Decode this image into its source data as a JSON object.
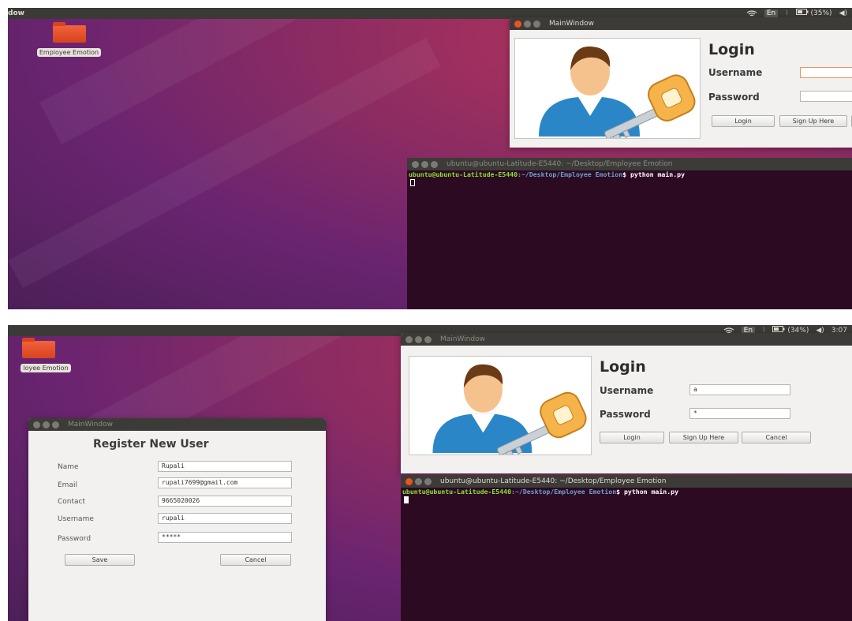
{
  "top_bar": {
    "app_title": "dow",
    "tray_lang": "En",
    "tray_battery_1": "(35%)",
    "tray_battery_2": "(34%)",
    "tray_time_2": "3:07"
  },
  "desktop": {
    "folder_label_1": "Employee Emotion",
    "folder_label_2": "loyee Emotion"
  },
  "login_window": {
    "title": "MainWindow",
    "heading": "Login",
    "username_label": "Username",
    "password_label": "Password",
    "username_value_2": "a",
    "password_value_2": "*",
    "login_button": "Login",
    "signup_button": "Sign Up Here",
    "cancel_button": "Cancel"
  },
  "terminal": {
    "title": "ubuntu@ubuntu-Latitude-E5440: ~/Desktop/Employee Emotion",
    "prompt_user": "ubuntu@ubuntu-Latitude-E5440",
    "prompt_path": ":~/Desktop/Employee Emotion",
    "command": "$ python main.py"
  },
  "register_window": {
    "title": "MainWindow",
    "heading": "Register New User",
    "fields": [
      {
        "label": "Name",
        "value": "Rupali"
      },
      {
        "label": "Email",
        "value": "rupali7699@gmail.com"
      },
      {
        "label": "Contact",
        "value": "9665020026"
      },
      {
        "label": "Username",
        "value": "rupali"
      },
      {
        "label": "Password",
        "value": "*****"
      }
    ],
    "save_button": "Save",
    "cancel_button": "Cancel"
  },
  "colors": {
    "ubuntu_orange": "#e95420",
    "terminal_bg": "#2c0a22",
    "prompt_green": "#8ae234",
    "prompt_blue": "#729fcf"
  },
  "icons": [
    "folder-icon",
    "login-user-key-icon",
    "wifi-icon",
    "battery-icon",
    "volume-icon",
    "window-close-icon"
  ]
}
